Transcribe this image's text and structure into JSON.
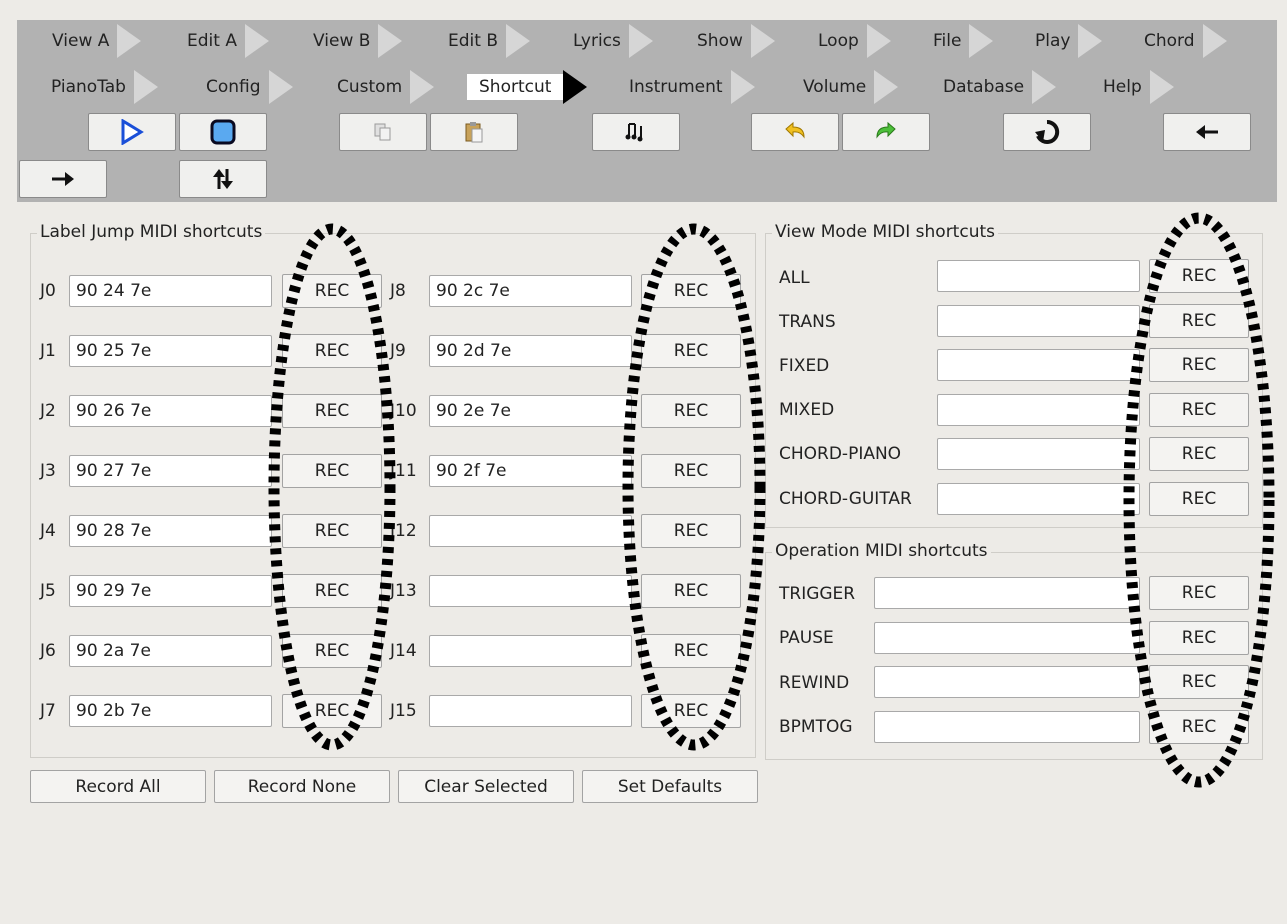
{
  "tabs": [
    {
      "label": "View A"
    },
    {
      "label": "Edit A"
    },
    {
      "label": "View B"
    },
    {
      "label": "Edit B"
    },
    {
      "label": "Lyrics"
    },
    {
      "label": "Show"
    },
    {
      "label": "Loop"
    },
    {
      "label": "File"
    },
    {
      "label": "Play"
    },
    {
      "label": "Chord"
    },
    {
      "label": "PianoTab"
    },
    {
      "label": "Config"
    },
    {
      "label": "Custom"
    },
    {
      "label": "Shortcut"
    },
    {
      "label": "Instrument"
    },
    {
      "label": "Volume"
    },
    {
      "label": "Database"
    },
    {
      "label": "Help"
    }
  ],
  "active_tab": "Shortcut",
  "toolbar_buttons": [
    {
      "icon": "play-icon"
    },
    {
      "icon": "stop-icon"
    },
    {
      "icon": "copy-icon"
    },
    {
      "icon": "paste-icon"
    },
    {
      "icon": "music-notes-icon"
    },
    {
      "icon": "undo-icon"
    },
    {
      "icon": "redo-icon"
    },
    {
      "icon": "rewind-icon"
    },
    {
      "icon": "arrow-left-icon"
    },
    {
      "icon": "arrow-right-icon"
    },
    {
      "icon": "swap-vertical-icon"
    }
  ],
  "label_jump": {
    "title": "Label Jump MIDI shortcuts",
    "rec_label": "REC",
    "left": [
      {
        "label": "J0",
        "value": "90 24 7e"
      },
      {
        "label": "J1",
        "value": "90 25 7e"
      },
      {
        "label": "J2",
        "value": "90 26 7e"
      },
      {
        "label": "J3",
        "value": "90 27 7e"
      },
      {
        "label": "J4",
        "value": "90 28 7e"
      },
      {
        "label": "J5",
        "value": "90 29 7e"
      },
      {
        "label": "J6",
        "value": "90 2a 7e"
      },
      {
        "label": "J7",
        "value": "90 2b 7e"
      }
    ],
    "right": [
      {
        "label": "J8",
        "value": "90 2c 7e"
      },
      {
        "label": "J9",
        "value": "90 2d 7e"
      },
      {
        "label": "J10",
        "value": "90 2e 7e"
      },
      {
        "label": "J11",
        "value": "90 2f 7e"
      },
      {
        "label": "J12",
        "value": ""
      },
      {
        "label": "J13",
        "value": ""
      },
      {
        "label": "J14",
        "value": ""
      },
      {
        "label": "J15",
        "value": ""
      }
    ]
  },
  "view_mode": {
    "title": "View Mode MIDI shortcuts",
    "rec_label": "REC",
    "rows": [
      {
        "label": "ALL",
        "value": ""
      },
      {
        "label": "TRANS",
        "value": ""
      },
      {
        "label": "FIXED",
        "value": ""
      },
      {
        "label": "MIXED",
        "value": ""
      },
      {
        "label": "CHORD-PIANO",
        "value": ""
      },
      {
        "label": "CHORD-GUITAR",
        "value": ""
      }
    ]
  },
  "operation": {
    "title": "Operation MIDI shortcuts",
    "rec_label": "REC",
    "rows": [
      {
        "label": "TRIGGER",
        "value": ""
      },
      {
        "label": "PAUSE",
        "value": ""
      },
      {
        "label": "REWIND",
        "value": ""
      },
      {
        "label": "BPMTOG",
        "value": ""
      }
    ]
  },
  "bottom_buttons": {
    "record_all": "Record All",
    "record_none": "Record None",
    "clear_selected": "Clear Selected",
    "set_defaults": "Set Defaults"
  },
  "colors": {
    "toolbar_bg": "#b2b2b2",
    "page_bg": "#edebe7",
    "play_icon": "#1a4fd8",
    "stop_icon": "#5aa9f0",
    "undo_icon": "#f0c020",
    "redo_icon": "#4cbf3a",
    "annotation": "#000000"
  }
}
